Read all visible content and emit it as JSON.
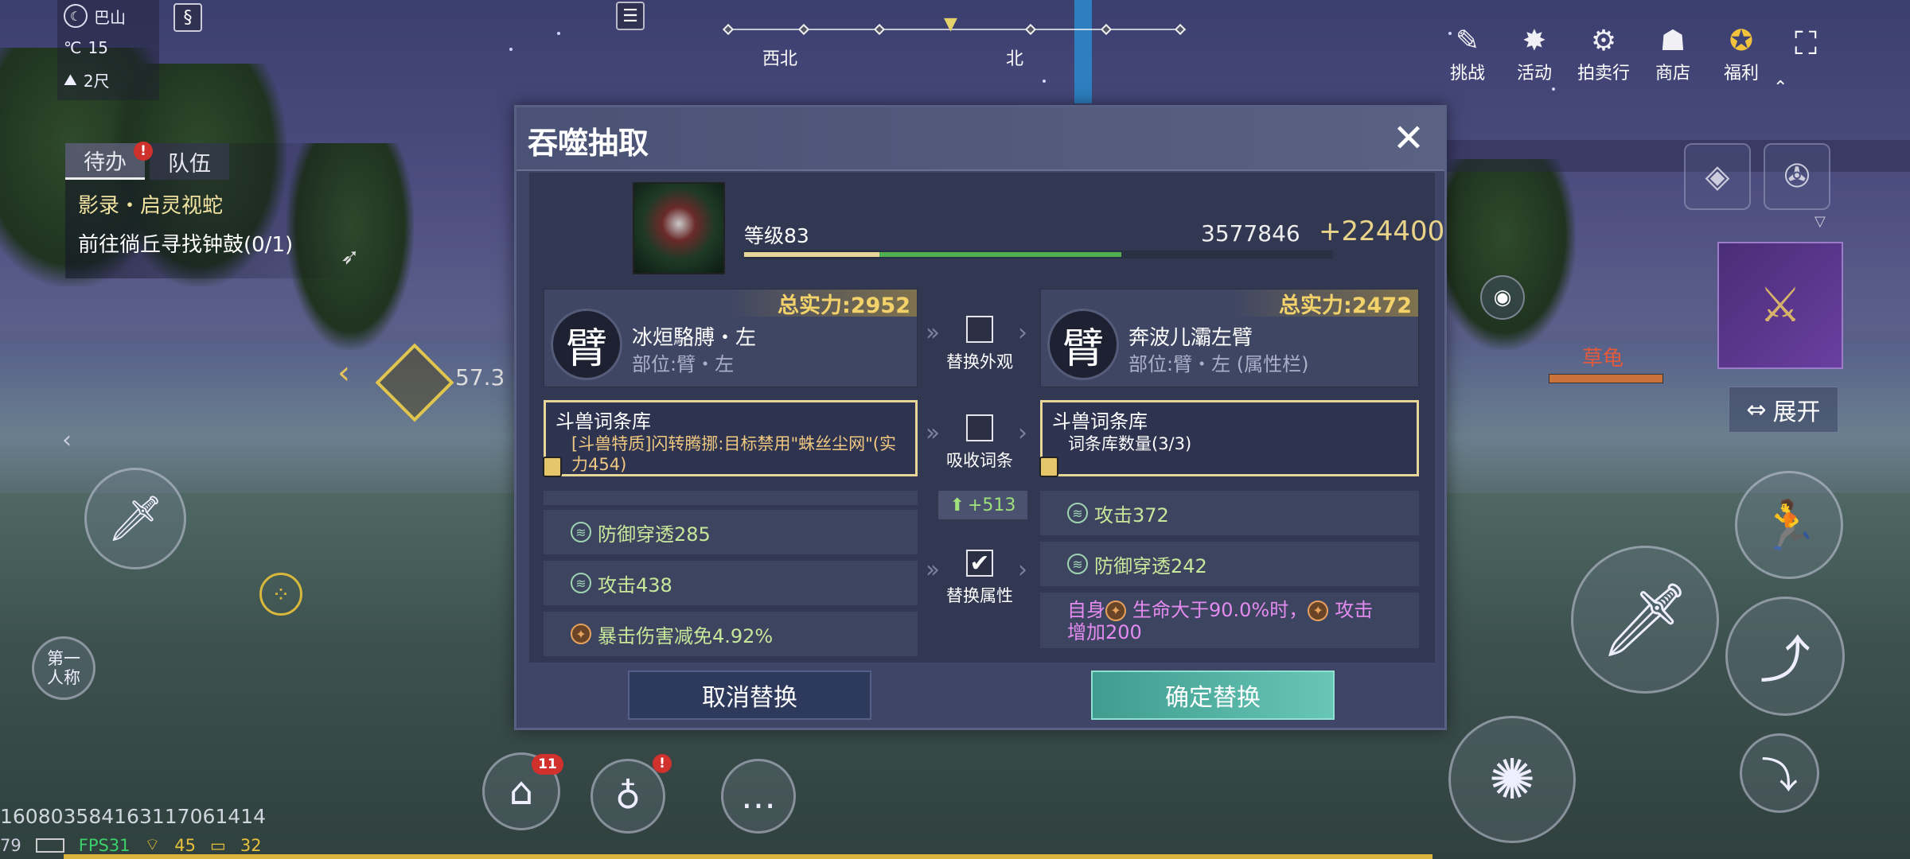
{
  "weather": {
    "location": "巴山",
    "temperature": "15",
    "temp_unit": "℃",
    "wind": "2尺"
  },
  "quest": {
    "tabs": [
      {
        "label": "待办"
      },
      {
        "label": "队伍"
      }
    ],
    "line1": "影录・启灵视蛇",
    "line2": "前往徜丘寻找钟鼓(0/1)"
  },
  "compass": {
    "west_north": "西北",
    "north": "北"
  },
  "distance": "57.3",
  "top_menu": [
    {
      "label": "挑战",
      "icon": "challenge-icon"
    },
    {
      "label": "活动",
      "icon": "activity-icon"
    },
    {
      "label": "拍卖行",
      "icon": "auction-icon"
    },
    {
      "label": "商店",
      "icon": "shop-icon"
    },
    {
      "label": "福利",
      "icon": "welfare-icon"
    }
  ],
  "dialog": {
    "title": "吞噬抽取",
    "level": "等级83",
    "power_value": "3577846",
    "power_delta": "+224400",
    "progress": {
      "gold_fraction": 0.23,
      "green_fraction": 0.41
    },
    "left_item": {
      "total_power": "总实力:2952",
      "name": "冰烜駱膊・左",
      "slot": "部位:臂・左",
      "glyph": "臂"
    },
    "right_item": {
      "total_power": "总实力:2472",
      "name": "奔波儿灞左臂",
      "slot": "部位:臂・左 (属性栏)",
      "glyph": "臂"
    },
    "replace_look": {
      "label": "替换外观",
      "checked": false
    },
    "absorb_entry": {
      "label": "吸收词条",
      "checked": false
    },
    "replace_attr": {
      "label": "替换属性",
      "checked": true
    },
    "attr_gain": "+513",
    "left_lib": {
      "title": "斗兽词条库",
      "text": "[斗兽特质]闪转腾挪:目标禁用\"蛛丝尘网\"(实力454)"
    },
    "right_lib": {
      "title": "斗兽词条库",
      "text": "词条库数量(3/3)"
    },
    "left_attrs": [
      {
        "text": "防御穿透285"
      },
      {
        "text": "攻击438"
      },
      {
        "text": "暴击伤害减免4.92%"
      }
    ],
    "right_attrs": [
      {
        "text": "攻击372"
      },
      {
        "text": "防御穿透242"
      }
    ],
    "right_special": {
      "prefix": "自身",
      "cond": "生命大于90.0%时，",
      "tail": "攻击",
      "line2": "增加200"
    },
    "cancel_label": "取消替换",
    "confirm_label": "确定替换"
  },
  "right_panel": {
    "expand_label": "展开",
    "npc_name": "草龟"
  },
  "first_person": {
    "line1": "第一",
    "line2": "人称"
  },
  "bottom": {
    "home_badge": "11",
    "id_text": "160803584163117061414",
    "ping": "79",
    "fps": "FPS31",
    "wifi": "45",
    "chat": "32"
  }
}
